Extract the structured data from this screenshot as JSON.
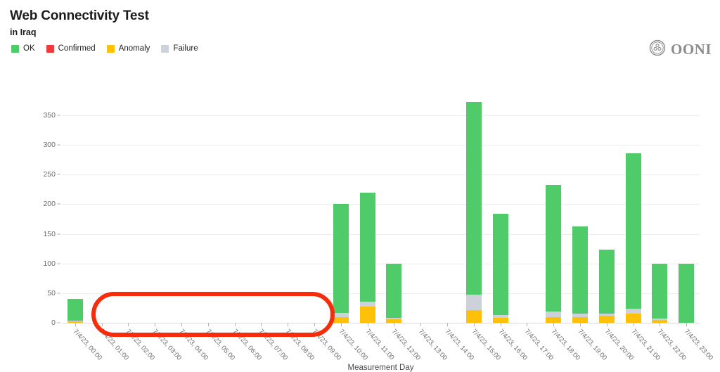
{
  "header": {
    "title": "Web Connectivity Test",
    "subtitle": "in Iraq"
  },
  "brand": {
    "name": "OONI",
    "logo_icon": "ooni-circle-logo-icon"
  },
  "legend": {
    "items": [
      {
        "label": "OK",
        "color": "#4FCB69"
      },
      {
        "label": "Confirmed",
        "color": "#F2393A"
      },
      {
        "label": "Anomaly",
        "color": "#FFC107"
      },
      {
        "label": "Failure",
        "color": "#CDD2DA"
      }
    ]
  },
  "annotation": {
    "shape": "rounded-rectangle",
    "color": "#F72C0A",
    "covers": "empty hours 01:00 through 09:00"
  },
  "chart_data": {
    "type": "bar",
    "stacked": true,
    "title": "Web Connectivity Test",
    "subtitle": "in Iraq",
    "xlabel": "Measurement Day",
    "ylabel": "",
    "ylim": [
      0,
      375
    ],
    "yticks": [
      0,
      50,
      100,
      150,
      200,
      250,
      300,
      350
    ],
    "grid": true,
    "legend_position": "top-left",
    "categories": [
      "7/4/23, 00:00",
      "7/4/23, 01:00",
      "7/4/23, 02:00",
      "7/4/23, 03:00",
      "7/4/23, 04:00",
      "7/4/23, 05:00",
      "7/4/23, 06:00",
      "7/4/23, 07:00",
      "7/4/23, 08:00",
      "7/4/23, 09:00",
      "7/4/23, 10:00",
      "7/4/23, 11:00",
      "7/4/23, 12:00",
      "7/4/23, 13:00",
      "7/4/23, 14:00",
      "7/4/23, 15:00",
      "7/4/23, 16:00",
      "7/4/23, 17:00",
      "7/4/23, 18:00",
      "7/4/23, 19:00",
      "7/4/23, 20:00",
      "7/4/23, 21:00",
      "7/4/23, 22:00",
      "7/4/23, 23:00"
    ],
    "series": [
      {
        "name": "Anomaly",
        "color": "#FFC107",
        "values": [
          3,
          0,
          0,
          0,
          0,
          0,
          0,
          0,
          0,
          0,
          10,
          27,
          6,
          0,
          0,
          21,
          8,
          0,
          10,
          10,
          12,
          15,
          5,
          0
        ]
      },
      {
        "name": "Failure",
        "color": "#CDD2DA",
        "values": [
          1,
          0,
          0,
          0,
          0,
          0,
          0,
          0,
          0,
          0,
          7,
          9,
          2,
          0,
          0,
          27,
          5,
          0,
          9,
          5,
          4,
          9,
          2,
          0
        ]
      },
      {
        "name": "Confirmed",
        "color": "#F2393A",
        "values": [
          0,
          0,
          0,
          0,
          0,
          0,
          0,
          0,
          0,
          0,
          0,
          0,
          0,
          0,
          0,
          0,
          0,
          0,
          0,
          0,
          0,
          0,
          0,
          0
        ]
      },
      {
        "name": "OK",
        "color": "#4FCB69",
        "values": [
          36,
          0,
          0,
          0,
          0,
          0,
          0,
          0,
          0,
          0,
          183,
          184,
          92,
          0,
          0,
          325,
          171,
          0,
          213,
          147,
          107,
          262,
          93,
          100
        ]
      }
    ],
    "totals": [
      40,
      0,
      0,
      0,
      0,
      0,
      0,
      0,
      0,
      0,
      200,
      220,
      100,
      0,
      0,
      373,
      184,
      0,
      232,
      162,
      123,
      286,
      100,
      100
    ]
  }
}
